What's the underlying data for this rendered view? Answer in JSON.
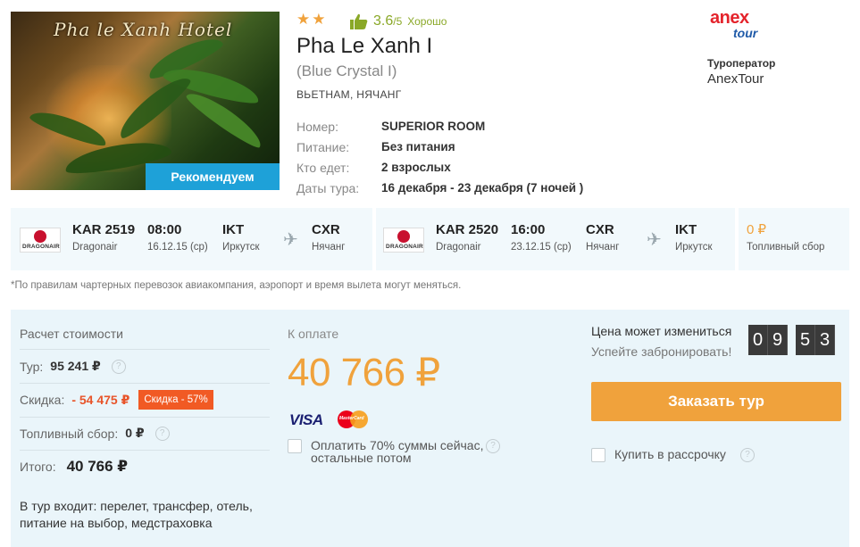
{
  "hotel": {
    "photo_sign": "Pha le Xanh Hotel",
    "recommend_label": "Рекомендуем",
    "stars": "★★",
    "rating_score": "3.6",
    "rating_of": "/5",
    "rating_label": "Хорошо",
    "name": "Pha Le Xanh I",
    "alt_name": "(Blue Crystal I)",
    "location": "ВЬЕТНАМ, НЯЧАНГ",
    "details": [
      {
        "label": "Номер:",
        "value": "SUPERIOR ROOM"
      },
      {
        "label": "Питание:",
        "value": "Без питания"
      },
      {
        "label": "Кто едет:",
        "value": "2 взрослых"
      },
      {
        "label": "Даты тура:",
        "value": "16 декабря - 23 декабря (7 ночей )"
      }
    ]
  },
  "operator": {
    "logo_top": "anex",
    "logo_bottom": "tour",
    "label": "Туроператор",
    "name": "AnexTour"
  },
  "flights": [
    {
      "airline_logo": "DRAGONAIR",
      "flight_no": "KAR 2519",
      "airline": "Dragonair",
      "time": "08:00",
      "date": "16.12.15 (ср)",
      "from_code": "IKT",
      "from_city": "Иркутск",
      "to_code": "CXR",
      "to_city": "Нячанг"
    },
    {
      "airline_logo": "DRAGONAIR",
      "flight_no": "KAR 2520",
      "airline": "Dragonair",
      "time": "16:00",
      "date": "23.12.15 (ср)",
      "from_code": "CXR",
      "from_city": "Нячанг",
      "to_code": "IKT",
      "to_city": "Иркутск"
    }
  ],
  "fuel_fee": {
    "value": "0 ₽",
    "label": "Топливный сбор"
  },
  "charter_note": "*По правилам чартерных перевозок авиакомпания, аэропорт и время вылета могут меняться.",
  "calc": {
    "title": "Расчет стоимости",
    "tour_label": "Тур:",
    "tour_value": "95 241 ₽",
    "discount_label": "Скидка:",
    "discount_value": "- 54 475 ₽",
    "discount_badge": "Скидка - 57%",
    "fuel_label": "Топливный сбор:",
    "fuel_value": "0 ₽",
    "total_label": "Итого:",
    "total_value": "40 766 ₽",
    "included": "В тур входит: перелет, трансфер, отель, питание на выбор, медстраховка"
  },
  "payment": {
    "label": "К оплате",
    "amount": "40 766 ₽",
    "visa": "VISA",
    "mastercard": "MasterCard",
    "partial_option": "Оплатить 70% суммы сейчас, остальные потом"
  },
  "order": {
    "price_change": "Цена может измениться",
    "hurry": "Успейте забронировать!",
    "timer": [
      "0",
      "9",
      "5",
      "3"
    ],
    "button": "Заказать тур",
    "installment": "Купить в рассрочку"
  },
  "colors": {
    "accent_orange": "#f0a23c",
    "recommend_blue": "#1ea1d8",
    "discount_red": "#f15a24",
    "panel_bg": "#eaf5fa",
    "rating_green": "#8aa827"
  }
}
